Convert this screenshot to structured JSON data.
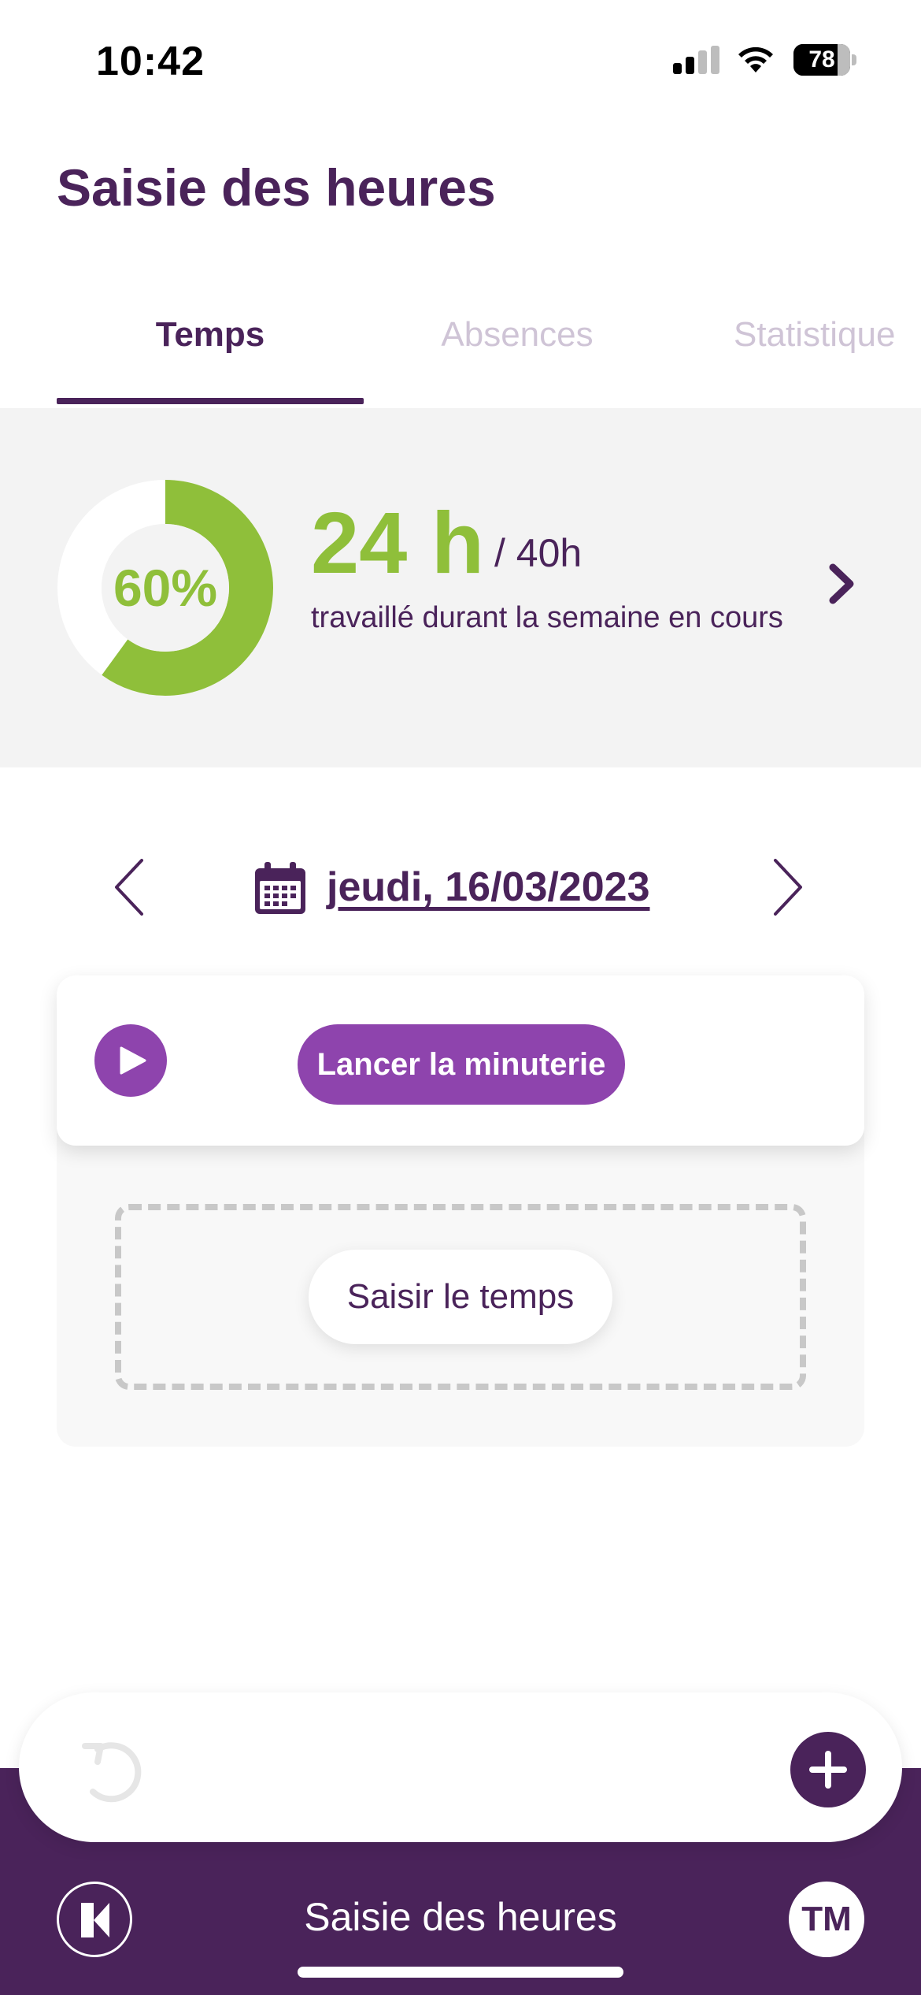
{
  "status_bar": {
    "time": "10:42",
    "battery": "78",
    "battery_level": 0.78
  },
  "header": {
    "title": "Saisie des heures"
  },
  "tabs": [
    {
      "label": "Temps",
      "active": true
    },
    {
      "label": "Absences",
      "active": false
    },
    {
      "label": "Statistique",
      "active": false
    }
  ],
  "summary": {
    "percent_label": "60%",
    "percent_value": 0.6,
    "hours_worked": "24 h",
    "hours_target": "/ 40h",
    "description": "travaillé durant la semaine en cours",
    "colors": {
      "accent": "#8fbf3a",
      "track": "#f3f3f3"
    }
  },
  "date_nav": {
    "date": "jeudi, 16/03/2023"
  },
  "timer": {
    "start_label": "Lancer la minuterie"
  },
  "entry": {
    "enter_time_label": "Saisir le temps"
  },
  "bottom": {
    "title": "Saisie des heures",
    "avatar_initials": "TM"
  },
  "colors": {
    "brand": "#4a235a",
    "accent_purple": "#8e44ad",
    "accent_green": "#8fbf3a"
  },
  "icons": {
    "signal": "signal-icon",
    "wifi": "wifi-icon",
    "battery": "battery-icon",
    "chevron_right": "chevron-right-icon",
    "chevron_left": "chevron-left-icon",
    "calendar": "calendar-icon",
    "play": "play-icon",
    "refresh": "refresh-icon",
    "add": "plus-icon",
    "logo": "app-logo-icon"
  }
}
